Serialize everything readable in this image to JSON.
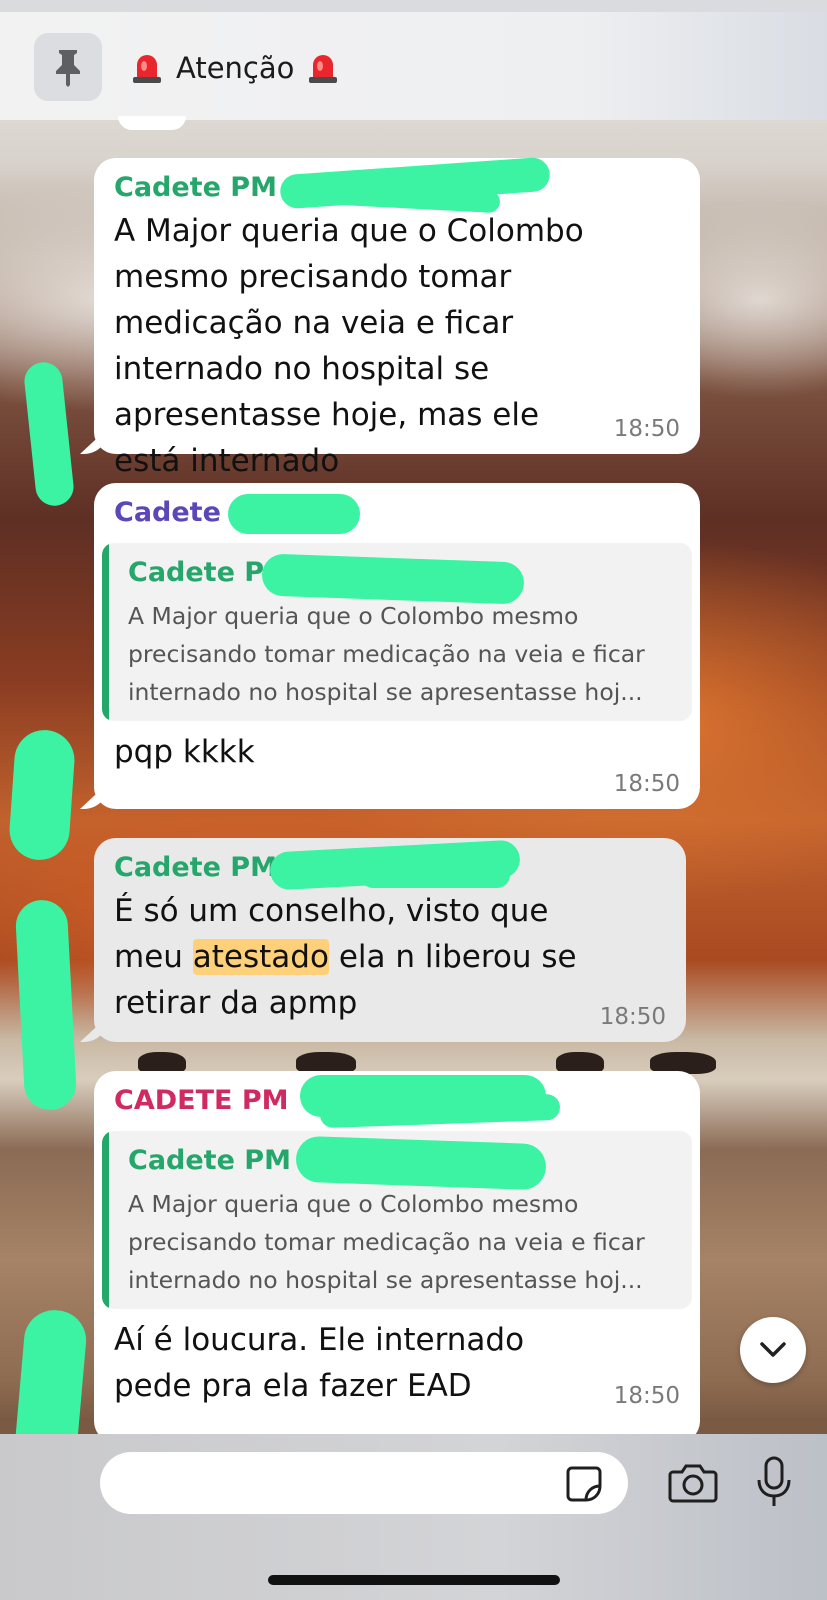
{
  "pinned": {
    "title": "Atenção",
    "pin_icon": "pin-icon",
    "emoji": "police-siren-emoji"
  },
  "messages": [
    {
      "sender": "Cadete PM",
      "sender_color": "#25a66b",
      "text": "A Major queria que o Colombo mesmo precisando tomar medicação na veia e ficar internado no hospital se apresentasse hoje, mas ele está internado",
      "time": "18:50"
    },
    {
      "sender": "Cadete",
      "sender_color": "#5b47b8",
      "quote": {
        "sender": "Cadete P",
        "text": "A Major queria que o Colombo mesmo precisando tomar medicação na veia e ficar internado no hospital se apresentasse hoj..."
      },
      "text": "pqp kkkk",
      "time": "18:50"
    },
    {
      "sender": "Cadete PM",
      "sender_color": "#25a66b",
      "text_before": "É só um conselho, visto que meu",
      "text_highlight": "atestado",
      "text_after": "ela n liberou se retirar da apmp",
      "time": "18:50"
    },
    {
      "sender": "CADETE PM",
      "sender_color": "#cf2b62",
      "quote": {
        "sender": "Cadete PM",
        "text": "A Major queria que o Colombo mesmo precisando tomar medicação na veia e ficar internado no hospital se apresentasse hoj..."
      },
      "text": "Aí é loucura. Ele internado pede pra ela fazer EAD",
      "time": "18:50"
    }
  ],
  "composer": {
    "input_value": "",
    "sticker_icon": "sticker-icon",
    "camera_icon": "camera-icon",
    "mic_icon": "microphone-icon"
  },
  "scroll_button_icon": "chevron-down-icon",
  "colors": {
    "sender_green": "#25a66b",
    "sender_purple": "#5b47b8",
    "sender_pink": "#cf2b62",
    "highlight": "#ffd07a",
    "redaction": "#3cf2a3"
  }
}
